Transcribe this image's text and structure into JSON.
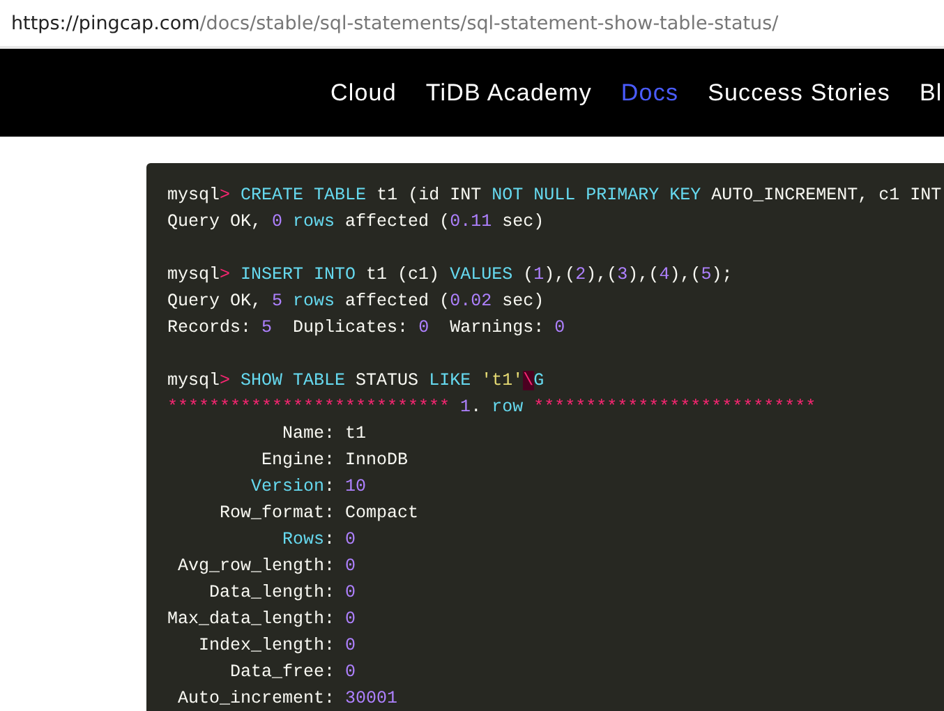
{
  "address_bar": {
    "url_host": "https://pingcap.com",
    "url_path": "/docs/stable/sql-statements/sql-statement-show-table-status/"
  },
  "nav": {
    "items": [
      {
        "label": "Cloud",
        "selected": false
      },
      {
        "label": "TiDB Academy",
        "selected": false
      },
      {
        "label": "Docs",
        "selected": true
      },
      {
        "label": "Success Stories",
        "selected": false
      },
      {
        "label": "Bl",
        "selected": false
      }
    ]
  },
  "code_block": {
    "blocks": [
      {
        "lines": [
          [
            {
              "kind": "plain",
              "text": "mysql"
            },
            {
              "kind": "prompt",
              "text": "> "
            },
            {
              "kind": "keyword",
              "text": "CREATE TABLE "
            },
            {
              "kind": "plain",
              "text": "t1 (id INT "
            },
            {
              "kind": "keyword",
              "text": "NOT NULL PRIMARY KEY "
            },
            {
              "kind": "plain",
              "text": "AUTO_INCREMENT, c1 INT"
            }
          ],
          [
            {
              "kind": "plain",
              "text": "Query OK, "
            },
            {
              "kind": "number",
              "text": "0"
            },
            {
              "kind": "keyword",
              "text": " rows"
            },
            {
              "kind": "plain",
              "text": " affected ("
            },
            {
              "kind": "number",
              "text": "0.11"
            },
            {
              "kind": "plain",
              "text": " sec)"
            }
          ]
        ]
      },
      {
        "lines": [
          [
            {
              "kind": "plain",
              "text": "mysql"
            },
            {
              "kind": "prompt",
              "text": "> "
            },
            {
              "kind": "keyword",
              "text": "INSERT INTO "
            },
            {
              "kind": "plain",
              "text": "t1 (c1) "
            },
            {
              "kind": "keyword",
              "text": "VALUES "
            },
            {
              "kind": "plain",
              "text": "("
            },
            {
              "kind": "number",
              "text": "1"
            },
            {
              "kind": "plain",
              "text": "),("
            },
            {
              "kind": "number",
              "text": "2"
            },
            {
              "kind": "plain",
              "text": "),("
            },
            {
              "kind": "number",
              "text": "3"
            },
            {
              "kind": "plain",
              "text": "),("
            },
            {
              "kind": "number",
              "text": "4"
            },
            {
              "kind": "plain",
              "text": "),("
            },
            {
              "kind": "number",
              "text": "5"
            },
            {
              "kind": "plain",
              "text": ");"
            }
          ],
          [
            {
              "kind": "plain",
              "text": "Query OK, "
            },
            {
              "kind": "number",
              "text": "5"
            },
            {
              "kind": "keyword",
              "text": " rows"
            },
            {
              "kind": "plain",
              "text": " affected ("
            },
            {
              "kind": "number",
              "text": "0.02"
            },
            {
              "kind": "plain",
              "text": " sec)"
            }
          ],
          [
            {
              "kind": "plain",
              "text": "Records: "
            },
            {
              "kind": "number",
              "text": "5"
            },
            {
              "kind": "plain",
              "text": "  Duplicates: "
            },
            {
              "kind": "number",
              "text": "0"
            },
            {
              "kind": "plain",
              "text": "  Warnings: "
            },
            {
              "kind": "number",
              "text": "0"
            }
          ]
        ]
      },
      {
        "lines": [
          [
            {
              "kind": "plain",
              "text": "mysql"
            },
            {
              "kind": "prompt",
              "text": "> "
            },
            {
              "kind": "keyword",
              "text": "SHOW TABLE "
            },
            {
              "kind": "plain",
              "text": "STATUS "
            },
            {
              "kind": "keyword",
              "text": "LIKE "
            },
            {
              "kind": "string",
              "text": "'t1'"
            },
            {
              "kind": "error",
              "text": "\\"
            },
            {
              "kind": "keyword",
              "text": "G"
            }
          ],
          [
            {
              "kind": "prompt",
              "text": "*************************** "
            },
            {
              "kind": "number",
              "text": "1"
            },
            {
              "kind": "plain",
              "text": ". "
            },
            {
              "kind": "keyword",
              "text": "row"
            },
            {
              "kind": "prompt",
              "text": " ***************************"
            }
          ],
          [
            {
              "kind": "plain",
              "text": "           Name: t1"
            }
          ],
          [
            {
              "kind": "plain",
              "text": "         Engine: InnoDB"
            }
          ],
          [
            {
              "kind": "keyword",
              "text": "        Version"
            },
            {
              "kind": "plain",
              "text": ": "
            },
            {
              "kind": "number",
              "text": "10"
            }
          ],
          [
            {
              "kind": "plain",
              "text": "     Row_format: Compact"
            }
          ],
          [
            {
              "kind": "keyword",
              "text": "           Rows"
            },
            {
              "kind": "plain",
              "text": ": "
            },
            {
              "kind": "number",
              "text": "0"
            }
          ],
          [
            {
              "kind": "plain",
              "text": " Avg_row_length: "
            },
            {
              "kind": "number",
              "text": "0"
            }
          ],
          [
            {
              "kind": "plain",
              "text": "    Data_length: "
            },
            {
              "kind": "number",
              "text": "0"
            }
          ],
          [
            {
              "kind": "plain",
              "text": "Max_data_length: "
            },
            {
              "kind": "number",
              "text": "0"
            }
          ],
          [
            {
              "kind": "plain",
              "text": "   Index_length: "
            },
            {
              "kind": "number",
              "text": "0"
            }
          ],
          [
            {
              "kind": "plain",
              "text": "      Data_free: "
            },
            {
              "kind": "number",
              "text": "0"
            }
          ],
          [
            {
              "kind": "plain",
              "text": " Auto_increment: "
            },
            {
              "kind": "number",
              "text": "30001"
            }
          ]
        ]
      }
    ]
  }
}
